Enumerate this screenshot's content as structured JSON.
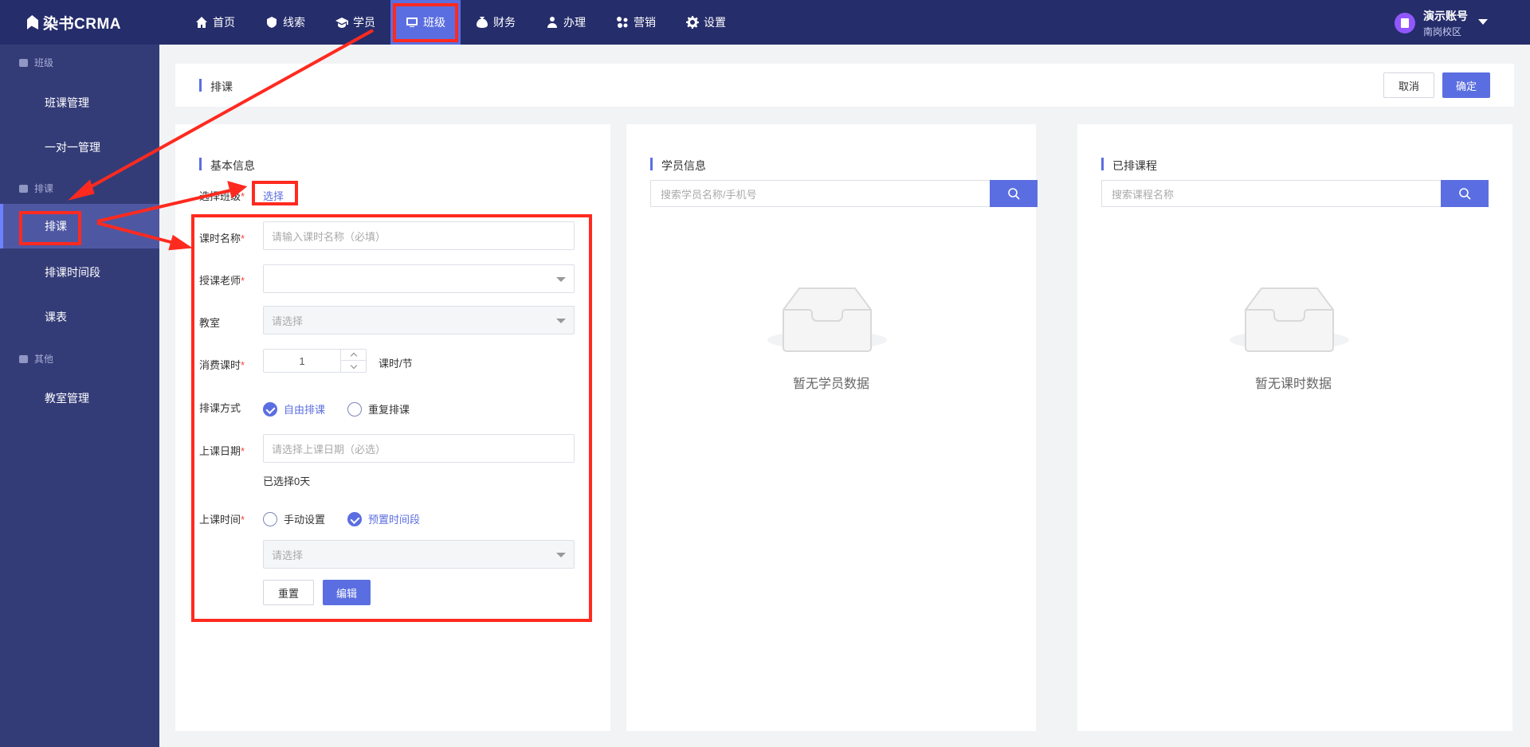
{
  "app": {
    "name": "染书CRMA"
  },
  "nav": [
    {
      "label": "首页",
      "icon": "home-icon"
    },
    {
      "label": "线索",
      "icon": "lead-icon"
    },
    {
      "label": "学员",
      "icon": "student-icon"
    },
    {
      "label": "班级",
      "icon": "class-icon",
      "active": true
    },
    {
      "label": "财务",
      "icon": "finance-icon"
    },
    {
      "label": "办理",
      "icon": "handle-icon"
    },
    {
      "label": "营销",
      "icon": "marketing-icon"
    },
    {
      "label": "设置",
      "icon": "settings-icon"
    }
  ],
  "user": {
    "name": "演示账号",
    "campus": "南岗校区"
  },
  "sidebar": {
    "groups": [
      {
        "label": "班级",
        "items": [
          "班课管理",
          "一对一管理"
        ]
      },
      {
        "label": "排课",
        "items": [
          "排课",
          "排课时间段",
          "课表"
        ]
      },
      {
        "label": "其他",
        "items": [
          "教室管理"
        ]
      }
    ],
    "active": "排课"
  },
  "header": {
    "title": "排课",
    "cancel": "取消",
    "confirm": "确定"
  },
  "basic": {
    "title": "基本信息",
    "select_class_label": "选择班级",
    "select_link": "选择",
    "lesson_name_label": "课时名称",
    "lesson_name_placeholder": "请输入课时名称（必填）",
    "teacher_label": "授课老师",
    "room_label": "教室",
    "room_placeholder": "请选择",
    "hours_label": "消费课时",
    "hours_value": "1",
    "hours_unit": "课时/节",
    "mode_label": "排课方式",
    "mode_free": "自由排课",
    "mode_repeat": "重复排课",
    "date_label": "上课日期",
    "date_placeholder": "请选择上课日期（必选）",
    "selected_days": "已选择0天",
    "time_label": "上课时间",
    "time_manual": "手动设置",
    "time_preset": "预置时间段",
    "time_placeholder": "请选择",
    "reset": "重置",
    "edit": "编辑"
  },
  "students": {
    "title": "学员信息",
    "search_placeholder": "搜索学员名称/手机号",
    "empty": "暂无学员数据"
  },
  "scheduled": {
    "title": "已排课程",
    "search_placeholder": "搜索课程名称",
    "empty": "暂无课时数据"
  },
  "colors": {
    "primary": "#5b6ee1",
    "topbar": "#252d6b",
    "sidebar": "#343c78",
    "annotation": "#ff2a1f"
  }
}
